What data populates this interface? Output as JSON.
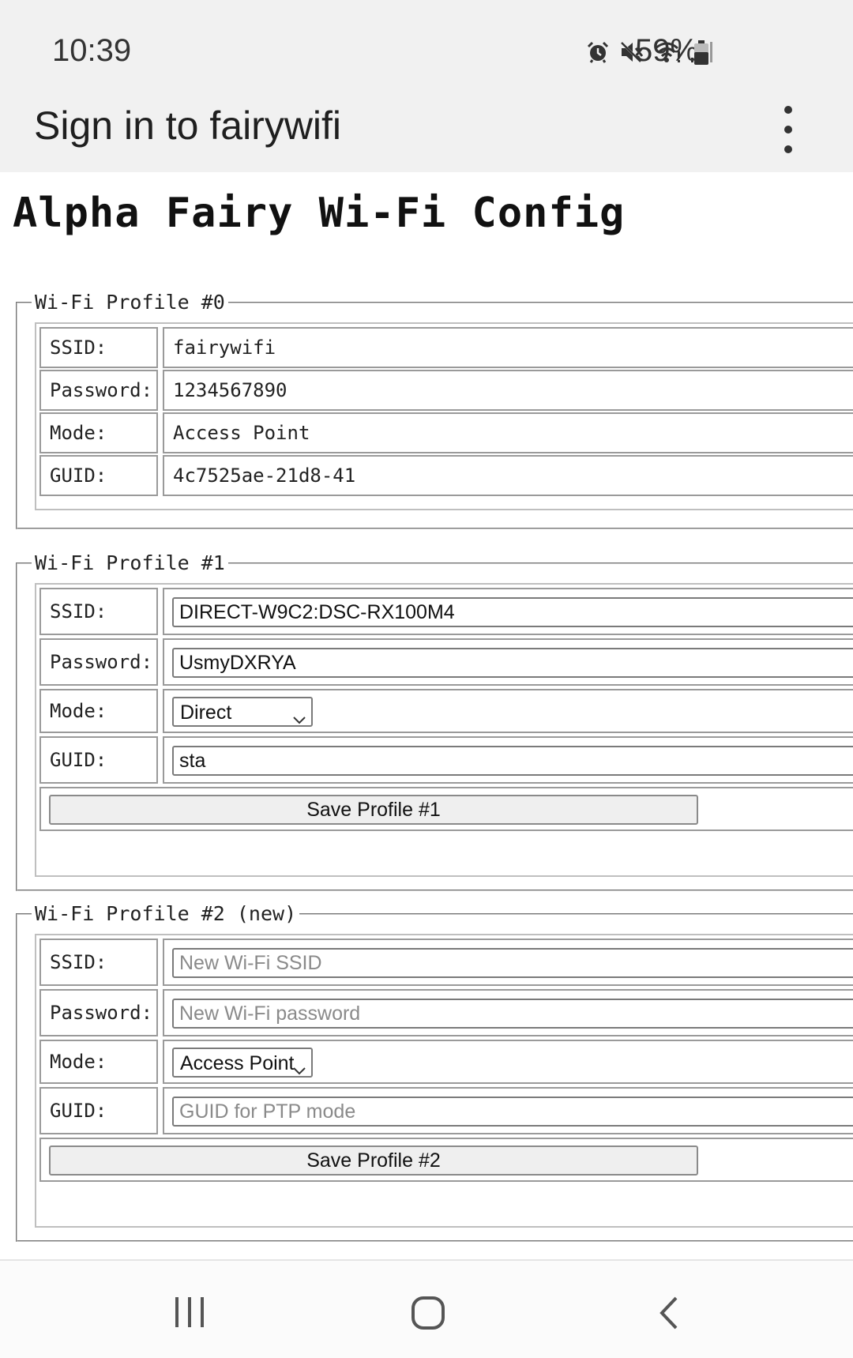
{
  "status_bar": {
    "time": "10:39",
    "battery_percent": "59%",
    "battery_level": 0.59,
    "icons": [
      "alarm-icon",
      "mute-icon",
      "wifi-icon",
      "signal-icon",
      "battery-icon"
    ]
  },
  "app_bar": {
    "title": "Sign in to fairywifi",
    "menu_icon": "more-vert-icon"
  },
  "page": {
    "heading": "Alpha Fairy Wi-Fi Config",
    "profiles": [
      {
        "legend": "Wi-Fi Profile #0",
        "ssid_label": "SSID:",
        "ssid": "fairywifi",
        "password_label": "Password:",
        "password": "1234567890",
        "mode_label": "Mode:",
        "mode": "Access Point",
        "guid_label": "GUID:",
        "guid": "4c7525ae-21d8-41"
      },
      {
        "legend": "Wi-Fi Profile #1",
        "ssid_label": "SSID:",
        "ssid": "DIRECT-W9C2:DSC-RX100M4",
        "password_label": "Password:",
        "password": "UsmyDXRYA",
        "mode_label": "Mode:",
        "mode": "Direct",
        "guid_label": "GUID:",
        "guid": "sta",
        "save_label": "Save Profile #1"
      },
      {
        "legend": "Wi-Fi Profile #2 (new)",
        "ssid_label": "SSID:",
        "ssid_placeholder": "New Wi-Fi SSID",
        "password_label": "Password:",
        "password_placeholder": "New Wi-Fi password",
        "mode_label": "Mode:",
        "mode": "Access Point",
        "guid_label": "GUID:",
        "guid_placeholder": "GUID for PTP mode",
        "save_label": "Save Profile #2"
      }
    ]
  },
  "nav_bar": {
    "recent_icon": "recent-apps-icon",
    "home_icon": "home-icon",
    "back_icon": "back-icon"
  }
}
